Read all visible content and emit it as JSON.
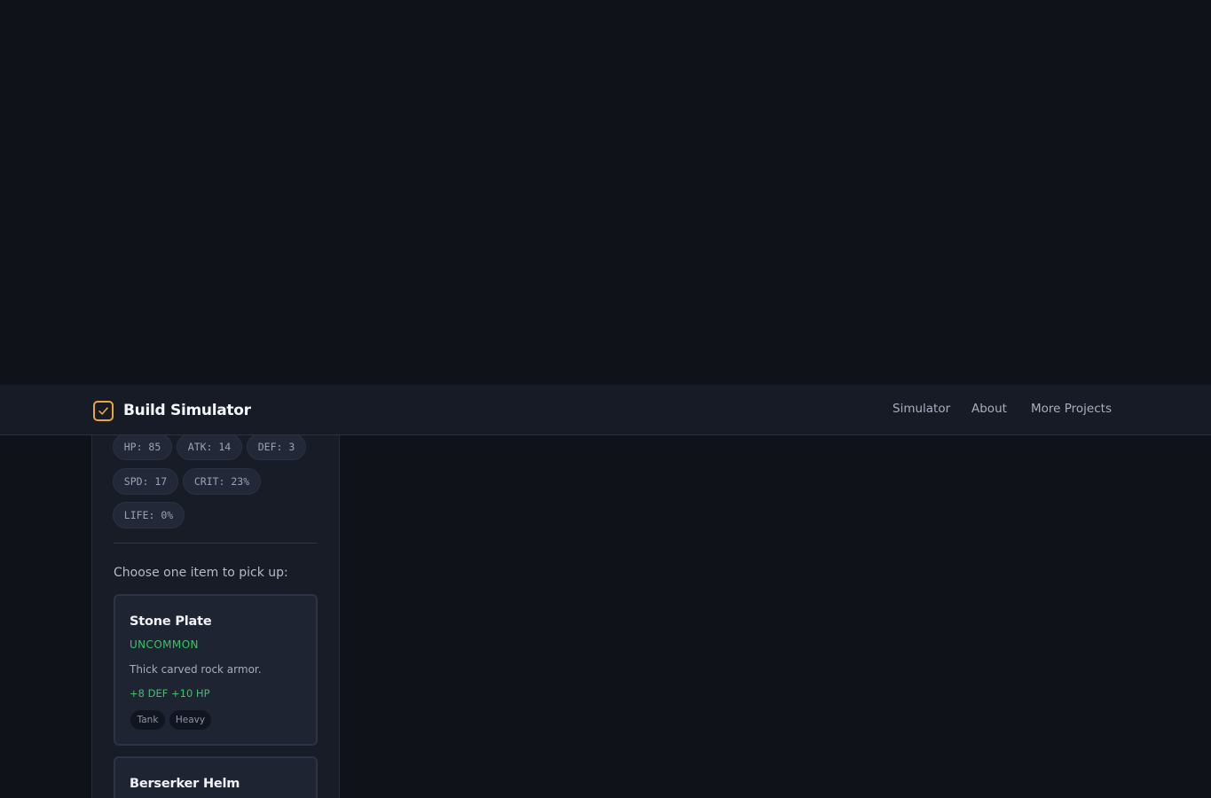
{
  "header": {
    "title": "Build Simulator",
    "nav": [
      "Simulator",
      "About",
      "More Projects"
    ]
  },
  "stats": [
    "HP: 85",
    "ATK: 14",
    "DEF: 3",
    "SPD: 17",
    "CRIT: 23%",
    "LIFE: 0%"
  ],
  "prompt": "Choose one item to pick up:",
  "items": [
    {
      "name": "Stone Plate",
      "rarity": "UNCOMMON",
      "description": "Thick carved rock armor.",
      "bonus": "+8 DEF +10 HP",
      "tags": [
        "Tank",
        "Heavy"
      ]
    },
    {
      "name": "Berserker Helm"
    }
  ],
  "colors": {
    "accent": "#e8a63b",
    "uncommon": "#3fc06a",
    "background": "#10121a",
    "panel": "#181c27"
  },
  "icons": {
    "brand": "checkbox-check-icon"
  }
}
